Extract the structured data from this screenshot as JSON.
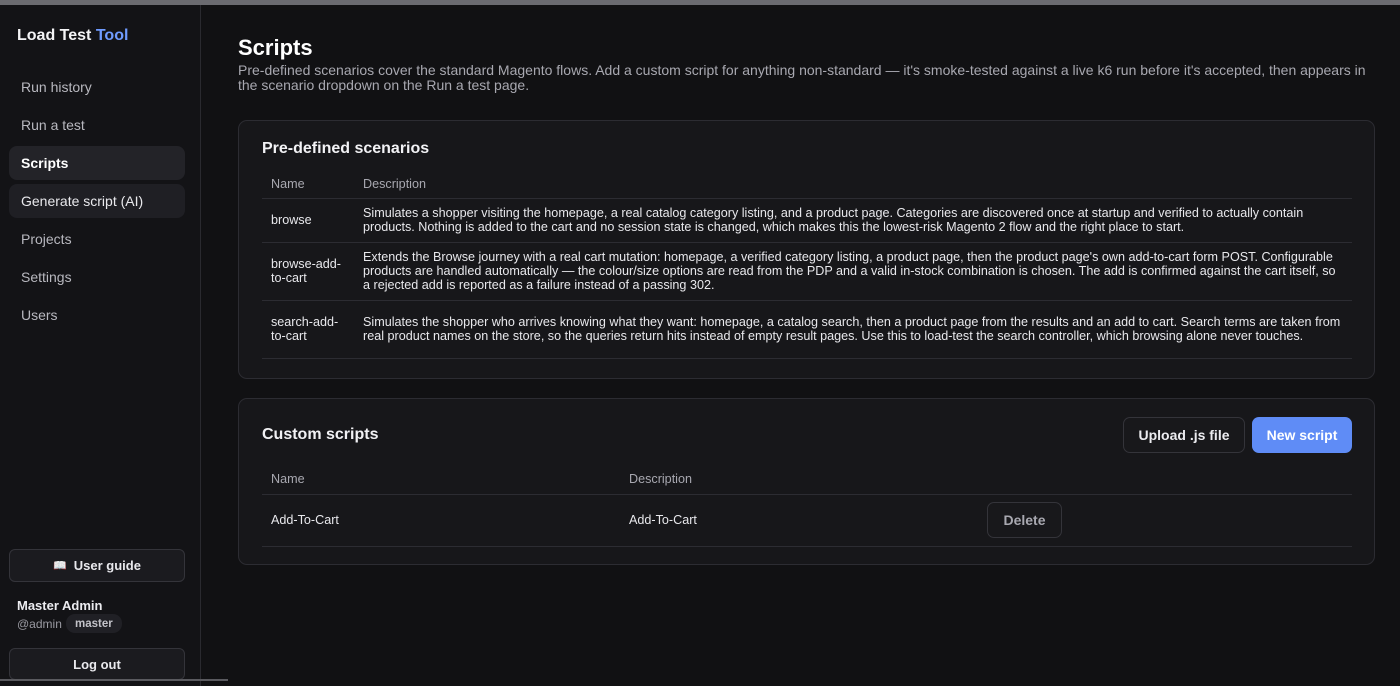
{
  "brand": {
    "name": "Load Test",
    "accent": "Tool"
  },
  "sidebar": {
    "items": [
      {
        "label": "Run history"
      },
      {
        "label": "Run a test"
      },
      {
        "label": "Scripts"
      },
      {
        "label": "Generate script (AI)"
      },
      {
        "label": "Projects"
      },
      {
        "label": "Settings"
      },
      {
        "label": "Users"
      }
    ],
    "active_item": "Scripts",
    "user_guide": {
      "label": "User guide",
      "icon": "book-icon"
    },
    "user": {
      "name": "Master Admin",
      "handle": "@admin",
      "role": "master"
    },
    "logout": "Log out"
  },
  "page": {
    "title": "Scripts",
    "description": "Pre-defined scenarios cover the standard Magento flows. Add a custom script for anything non-standard — it's smoke-tested against a live k6 run before it's accepted, then appears in the scenario dropdown on the Run a test page."
  },
  "predefined": {
    "title": "Pre-defined scenarios",
    "columns": [
      "Name",
      "Description"
    ],
    "rows": [
      {
        "name": "browse",
        "description": "Simulates a shopper visiting the homepage, a real catalog category listing, and a product page. Categories are discovered once at startup and verified to actually contain products. Nothing is added to the cart and no session state is changed, which makes this the lowest-risk Magento 2 flow and the right place to start."
      },
      {
        "name": "browse-add-to-cart",
        "description": "Extends the Browse journey with a real cart mutation: homepage, a verified category listing, a product page, then the product page's own add-to-cart form POST. Configurable products are handled automatically — the colour/size options are read from the PDP and a valid in-stock combination is chosen. The add is confirmed against the cart itself, so a rejected add is reported as a failure instead of a passing 302."
      },
      {
        "name": "search-add-to-cart",
        "description": "Simulates the shopper who arrives knowing what they want: homepage, a catalog search, then a product page from the results and an add to cart. Search terms are taken from real product names on the store, so the queries return hits instead of empty result pages. Use this to load-test the search controller, which browsing alone never touches."
      }
    ]
  },
  "custom": {
    "title": "Custom scripts",
    "upload_label": "Upload .js file",
    "new_label": "New script",
    "columns": [
      "Name",
      "Description",
      ""
    ],
    "rows": [
      {
        "name": "Add-To-Cart",
        "description": "Add-To-Cart",
        "action": "Delete"
      }
    ]
  },
  "colors": {
    "accent": "#6f9bff",
    "primary_button": "#5f8cf6",
    "background": "#111113"
  }
}
